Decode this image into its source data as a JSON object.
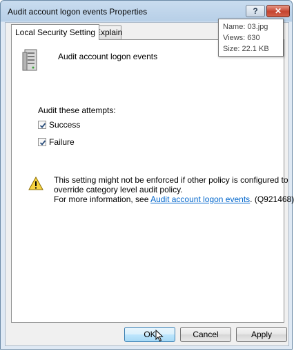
{
  "window": {
    "title": "Audit account logon events Properties",
    "help_glyph": "?",
    "close_glyph": "✕"
  },
  "tabs": [
    {
      "label": "Local Security Setting",
      "active": true
    },
    {
      "label": "Explain",
      "active": false
    }
  ],
  "policy": {
    "name": "Audit account logon events",
    "icon": "server-policy-icon"
  },
  "audit": {
    "label": "Audit these attempts:",
    "options": [
      {
        "label": "Success",
        "checked": true
      },
      {
        "label": "Failure",
        "checked": true
      }
    ]
  },
  "warning": {
    "icon": "warning-icon",
    "line1": "This setting might not be enforced if other policy is configured to",
    "line2": "override category level audit policy.",
    "line3_prefix": "For more information, see",
    "link_text": "Audit account logon events",
    "line3_suffix": ". (Q921468)"
  },
  "buttons": {
    "ok": "OK",
    "cancel": "Cancel",
    "apply": "Apply"
  },
  "tooltip": {
    "name": "Name:  03.jpg",
    "views": "Views: 630",
    "size": "Size:  22.1 KB"
  },
  "colors": {
    "link": "#0066cc",
    "close_button": "#c5442f",
    "default_button_border": "#3c7fb1"
  }
}
